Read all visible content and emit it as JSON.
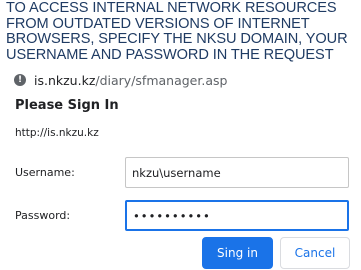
{
  "banner": {
    "text": "TO ACCESS INTERNAL NETWORK RESOURCES FROM OUTDATED VERSIONS OF INTERNET BROWSERS, SPECIFY THE NKSU DOMAIN, YOUR USERNAME AND PASSWORD IN THE REQUEST"
  },
  "address": {
    "icon": "info-icon",
    "host": "is.nkzu.kz",
    "path": "/diary/sfmanager.asp"
  },
  "dialog": {
    "title": "Please Sign In",
    "site": "http://is.nkzu.kz",
    "username_label": "Username:",
    "username_value": "nkzu\\username",
    "password_label": "Password:",
    "password_value": "••••••••••",
    "signin_label": "Sing in",
    "cancel_label": "Cancel"
  },
  "colors": {
    "accent": "#1a73e8",
    "banner_text": "#1f3b63"
  }
}
